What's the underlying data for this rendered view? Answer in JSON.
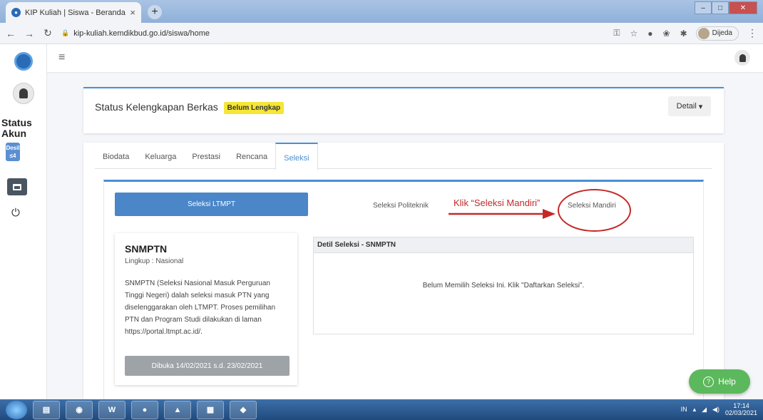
{
  "browser": {
    "tab_title": "KIP Kuliah | Siswa - Beranda",
    "tab_close": "×",
    "newtab": "+",
    "url": "kip-kuliah.kemdikbud.go.id/siswa/home",
    "profile_name": "Dijeda"
  },
  "sidebar": {
    "status_label": "Status Akun",
    "desil_line1": "Desil",
    "desil_line2": "≤4"
  },
  "status_card": {
    "title": "Status Kelengkapan Berkas",
    "badge": "Belum Lengkap",
    "detail_button": "Detail"
  },
  "tabs": [
    {
      "label": "Biodata"
    },
    {
      "label": "Keluarga"
    },
    {
      "label": "Prestasi"
    },
    {
      "label": "Rencana"
    },
    {
      "label": "Seleksi",
      "active": true
    }
  ],
  "selection": {
    "ltmpt": "Seleksi LTMPT",
    "politeknik": "Seleksi Politeknik",
    "mandiri": "Seleksi Mandiri",
    "annotation": "Klik “Seleksi Mandiri”"
  },
  "snmptn": {
    "title": "SNMPTN",
    "scope": "Lingkup : Nasional",
    "description": "SNMPTN (Seleksi Nasional Masuk Perguruan Tinggi Negeri) dalah seleksi masuk PTN yang diselenggarakan oleh LTMPT. Proses pemilihan PTN dan Program Studi dilakukan di laman https://portal.ltmpt.ac.id/.",
    "date_button": "Dibuka 14/02/2021 s.d. 23/02/2021"
  },
  "detail": {
    "header": "Detil Seleksi - SNMPTN",
    "message": "Belum Memilih Seleksi Ini. Klik \"Daftarkan Seleksi\"."
  },
  "help": {
    "label": "Help",
    "icon": "?"
  },
  "taskbar": {
    "word_label": "W",
    "tray_lang": "IN",
    "time": "17:14",
    "date": "02/03/2021"
  },
  "colors": {
    "accent": "#4a8fd4",
    "badge": "#f5e637",
    "annotation": "#c62828",
    "help": "#5cb85c"
  }
}
